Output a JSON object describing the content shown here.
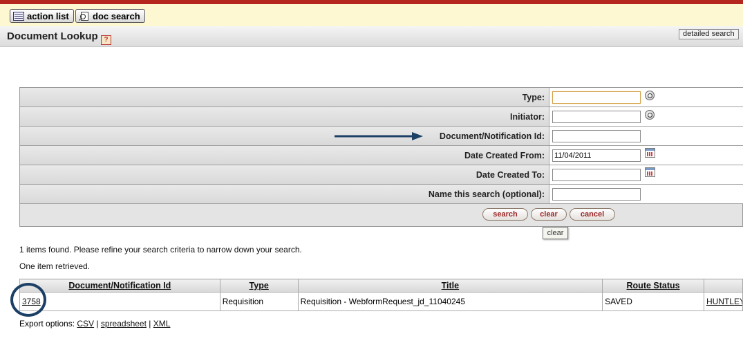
{
  "topbar": {
    "action_list_label": "action list",
    "doc_search_label": "doc search"
  },
  "header": {
    "title": "Document Lookup",
    "help_glyph": "?",
    "detailed_search_label": "detailed search"
  },
  "criteria": {
    "type_label": "Type:",
    "type_value": "",
    "initiator_label": "Initiator:",
    "initiator_value": "",
    "doc_id_label": "Document/Notification Id:",
    "doc_id_value": "",
    "date_from_label": "Date Created From:",
    "date_from_value": "11/04/2011",
    "date_to_label": "Date Created To:",
    "date_to_value": "",
    "name_search_label": "Name this search (optional):",
    "name_search_value": ""
  },
  "buttons": {
    "search": "search",
    "clear": "clear",
    "cancel": "cancel"
  },
  "tooltip": "clear",
  "messages": {
    "found": "1 items found. Please refine your search criteria to narrow down your search.",
    "retrieved": "One item retrieved."
  },
  "results": {
    "columns": [
      "Document/Notification Id",
      "Type",
      "Title",
      "Route Status"
    ],
    "rows": [
      {
        "id": "3758",
        "type": "Requisition",
        "title": "Requisition - WebformRequest_jd_11040245",
        "status": "SAVED",
        "initiator": "HUNTLEY,"
      }
    ]
  },
  "export": {
    "label": "Export options:",
    "csv": "CSV",
    "spreadsheet": "spreadsheet",
    "xml": "XML",
    "sep": "|"
  },
  "colors": {
    "topbar_bg": "#fdf8d2",
    "top_accent": "#b5261f",
    "button_text": "#9a2626",
    "annotation": "#1c3f66"
  }
}
